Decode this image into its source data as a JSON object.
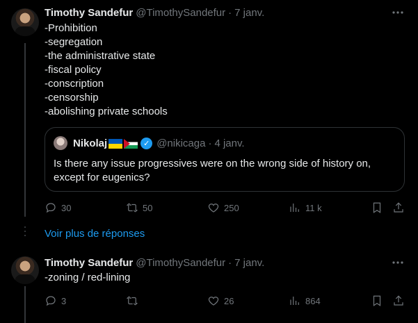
{
  "tweet1": {
    "name": "Timothy Sandefur",
    "handle": "@TimothySandefur",
    "separator": "·",
    "time": "7 janv.",
    "lines": [
      "-Prohibition",
      "-segregation",
      "-the administrative state",
      "-fiscal policy",
      "-conscription",
      "-censorship",
      "-abolishing private schools"
    ],
    "quote": {
      "name": "Nikolaj",
      "handle": "@nikicaga",
      "separator": "·",
      "time": "4 janv.",
      "text": "Is there any issue progressives were on the wrong side of history on, except for eugenics?"
    },
    "actions": {
      "replies": "30",
      "retweets": "50",
      "likes": "250",
      "views": "11 k"
    }
  },
  "more_replies": "Voir plus de réponses",
  "tweet2": {
    "name": "Timothy Sandefur",
    "handle": "@TimothySandefur",
    "separator": "·",
    "time": "7 janv.",
    "text": "-zoning / red-lining",
    "actions": {
      "replies": "3",
      "retweets": "",
      "likes": "26",
      "views": "864"
    }
  },
  "colors": {
    "background": "#000000",
    "text": "#e7e9ea",
    "muted": "#71767b",
    "accent": "#1d9bf0",
    "border": "#2f3336"
  }
}
